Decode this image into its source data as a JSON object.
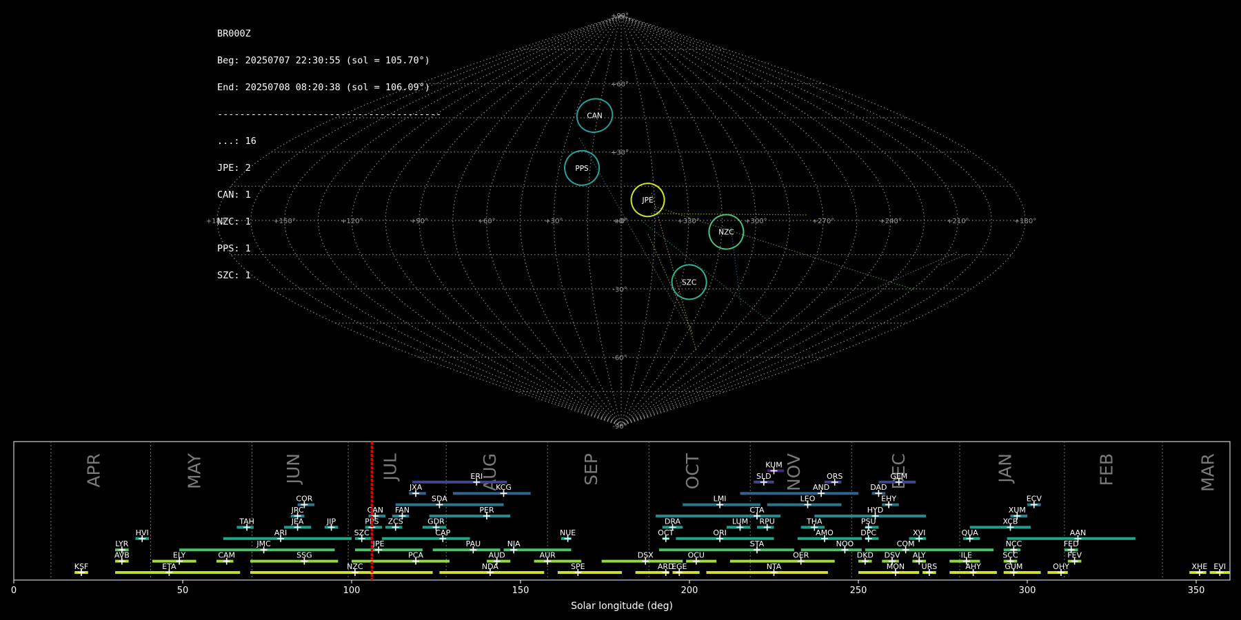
{
  "header": {
    "station": "BR000Z",
    "beg": "Beg: 20250707 22:30:55 (sol = 105.70°)",
    "end": "End: 20250708 08:20:38 (sol = 106.09°)",
    "divider": "----------------------------------------",
    "counts": [
      "...: 16",
      "JPE: 2",
      "CAN: 1",
      "NZC: 1",
      "PPS: 1",
      "SZC: 1"
    ]
  },
  "sky_map": {
    "projection": "sinusoidal",
    "lon_labels": [
      "+180°",
      "+150°",
      "+120°",
      "+90°",
      "+60°",
      "+30°",
      "+0°",
      "+330°",
      "+300°",
      "+270°",
      "+240°",
      "+210°",
      "+180°"
    ],
    "lat_labels": [
      "+90°",
      "+60°",
      "+30°",
      "+0°",
      "-30°",
      "-60°",
      "-90°"
    ],
    "lat_label_values": [
      90,
      60,
      30,
      0,
      -30,
      -60,
      -90
    ],
    "showers": [
      {
        "code": "CAN",
        "lon": -17,
        "lat": 46,
        "rx": 26,
        "ry": 24,
        "color": "#2a9e9e"
      },
      {
        "code": "PPS",
        "lon": -19,
        "lat": 23,
        "rx": 25,
        "ry": 25,
        "color": "#28a3a0"
      },
      {
        "code": "JPE",
        "lon": 12,
        "lat": 9,
        "rx": 24,
        "ry": 24,
        "color": "#cfe02a"
      },
      {
        "code": "NZC",
        "lon": 47,
        "lat": -5,
        "rx": 25,
        "ry": 25,
        "color": "#48c47a"
      },
      {
        "code": "SZC",
        "lon": 34,
        "lat": -27,
        "rx": 25,
        "ry": 25,
        "color": "#31b39a"
      }
    ]
  },
  "chart_data": {
    "type": "range_timeline",
    "xlabel": "Solar longitude (deg)",
    "xlim": [
      0,
      360
    ],
    "xticks": [
      0,
      50,
      100,
      150,
      200,
      250,
      300,
      350
    ],
    "current_sol": 106,
    "months": [
      {
        "name": "APR",
        "start": 11
      },
      {
        "name": "MAY",
        "start": 40.5
      },
      {
        "name": "JUN",
        "start": 70.5
      },
      {
        "name": "JUL",
        "start": 99
      },
      {
        "name": "AUG",
        "start": 128
      },
      {
        "name": "SEP",
        "start": 158
      },
      {
        "name": "OCT",
        "start": 188
      },
      {
        "name": "NOV",
        "start": 218
      },
      {
        "name": "DEC",
        "start": 248
      },
      {
        "name": "JAN",
        "start": 280
      },
      {
        "name": "FEB",
        "start": 311
      },
      {
        "name": "MAR",
        "start": 340
      }
    ],
    "showers": [
      {
        "code": "KSF",
        "start": 18,
        "end": 22,
        "peak": 20,
        "row": 0,
        "color": "#cfe02a"
      },
      {
        "code": "ETA",
        "start": 30,
        "end": 67,
        "peak": 46,
        "row": 0,
        "color": "#b8de29"
      },
      {
        "code": "NZC",
        "start": 70,
        "end": 124,
        "peak": 101,
        "row": 0,
        "color": "#cfe02a"
      },
      {
        "code": "NDA",
        "start": 126,
        "end": 157,
        "peak": 141,
        "row": 0,
        "color": "#cfe02a"
      },
      {
        "code": "SPE",
        "start": 161,
        "end": 180,
        "peak": 167,
        "row": 0,
        "color": "#cfe02a"
      },
      {
        "code": "ARD",
        "start": 184,
        "end": 194,
        "peak": 193,
        "row": 0,
        "color": "#cfe02a"
      },
      {
        "code": "EGE",
        "start": 195,
        "end": 203,
        "peak": 197,
        "row": 0,
        "color": "#cfe02a"
      },
      {
        "code": "NTA",
        "start": 205,
        "end": 241,
        "peak": 225,
        "row": 0,
        "color": "#cfe02a"
      },
      {
        "code": "MON",
        "start": 250,
        "end": 268,
        "peak": 261,
        "row": 0,
        "color": "#cfe02a"
      },
      {
        "code": "URS",
        "start": 269,
        "end": 273,
        "peak": 271,
        "row": 0,
        "color": "#cfe02a"
      },
      {
        "code": "AHY",
        "start": 277,
        "end": 291,
        "peak": 284,
        "row": 0,
        "color": "#cfe02a"
      },
      {
        "code": "GUM",
        "start": 293,
        "end": 304,
        "peak": 296,
        "row": 0,
        "color": "#cfe02a"
      },
      {
        "code": "OHY",
        "start": 306,
        "end": 312,
        "peak": 310,
        "row": 0,
        "color": "#cfe02a"
      },
      {
        "code": "XHE",
        "start": 348,
        "end": 353,
        "peak": 351,
        "row": 0,
        "color": "#cfe02a"
      },
      {
        "code": "EVI",
        "start": 354,
        "end": 360,
        "peak": 357,
        "row": 0,
        "color": "#cfe02a"
      },
      {
        "code": "AVB",
        "start": 30,
        "end": 34,
        "peak": 32,
        "row": 1,
        "color": "#b8de29"
      },
      {
        "code": "ELY",
        "start": 41,
        "end": 54,
        "peak": 49,
        "row": 1,
        "color": "#a5db36"
      },
      {
        "code": "CAM",
        "start": 60,
        "end": 65,
        "peak": 63,
        "row": 1,
        "color": "#a5db36"
      },
      {
        "code": "SSG",
        "start": 70,
        "end": 96,
        "peak": 86,
        "row": 1,
        "color": "#93d741"
      },
      {
        "code": "PCA",
        "start": 100,
        "end": 129,
        "peak": 119,
        "row": 1,
        "color": "#93d741"
      },
      {
        "code": "AUD",
        "start": 140,
        "end": 147,
        "peak": 143,
        "row": 1,
        "color": "#93d741"
      },
      {
        "code": "AUR",
        "start": 154,
        "end": 168,
        "peak": 158,
        "row": 1,
        "color": "#93d741"
      },
      {
        "code": "DSX",
        "start": 174,
        "end": 198,
        "peak": 187,
        "row": 1,
        "color": "#93d741"
      },
      {
        "code": "OCU",
        "start": 199,
        "end": 208,
        "peak": 202,
        "row": 1,
        "color": "#a5db36"
      },
      {
        "code": "OER",
        "start": 212,
        "end": 243,
        "peak": 233,
        "row": 1,
        "color": "#a5db36"
      },
      {
        "code": "DKD",
        "start": 250,
        "end": 254,
        "peak": 252,
        "row": 1,
        "color": "#93d741"
      },
      {
        "code": "DSV",
        "start": 257,
        "end": 262,
        "peak": 260,
        "row": 1,
        "color": "#93d741"
      },
      {
        "code": "ALY",
        "start": 266,
        "end": 270,
        "peak": 268,
        "row": 1,
        "color": "#93d741"
      },
      {
        "code": "ILE",
        "start": 277,
        "end": 286,
        "peak": 282,
        "row": 1,
        "color": "#93d741"
      },
      {
        "code": "SCC",
        "start": 293,
        "end": 297,
        "peak": 295,
        "row": 1,
        "color": "#93d741"
      },
      {
        "code": "FEV",
        "start": 312,
        "end": 316,
        "peak": 314,
        "row": 1,
        "color": "#93d741"
      },
      {
        "code": "LYR",
        "start": 30,
        "end": 34,
        "peak": 32,
        "row": 2,
        "color": "#5ec962"
      },
      {
        "code": "JMC",
        "start": 49,
        "end": 95,
        "peak": 74,
        "row": 2,
        "color": "#4ac16d"
      },
      {
        "code": "JPE",
        "start": 101,
        "end": 121,
        "peak": 108,
        "row": 2,
        "color": "#4ac16d"
      },
      {
        "code": "PAU",
        "start": 124,
        "end": 144,
        "peak": 136,
        "row": 2,
        "color": "#4ac16d"
      },
      {
        "code": "NIA",
        "start": 145,
        "end": 165,
        "peak": 148,
        "row": 2,
        "color": "#4ac16d"
      },
      {
        "code": "STA",
        "start": 191,
        "end": 231,
        "peak": 220,
        "row": 2,
        "color": "#4ac16d"
      },
      {
        "code": "NOO",
        "start": 233,
        "end": 251,
        "peak": 246,
        "row": 2,
        "color": "#4ac16d"
      },
      {
        "code": "COM",
        "start": 252,
        "end": 290,
        "peak": 264,
        "row": 2,
        "color": "#4ac16d"
      },
      {
        "code": "NCC",
        "start": 293,
        "end": 298,
        "peak": 296,
        "row": 2,
        "color": "#4ac16d"
      },
      {
        "code": "FED",
        "start": 311,
        "end": 315,
        "peak": 313,
        "row": 2,
        "color": "#4ac16d"
      },
      {
        "code": "HVI",
        "start": 36,
        "end": 40,
        "peak": 38,
        "row": 3,
        "color": "#22a884"
      },
      {
        "code": "ARI",
        "start": 62,
        "end": 100,
        "peak": 79,
        "row": 3,
        "color": "#22a884"
      },
      {
        "code": "SZC",
        "start": 101,
        "end": 106,
        "peak": 103,
        "row": 3,
        "color": "#22a884"
      },
      {
        "code": "CAP",
        "start": 109,
        "end": 135,
        "peak": 127,
        "row": 3,
        "color": "#22a884"
      },
      {
        "code": "NUE",
        "start": 162,
        "end": 165,
        "peak": 164,
        "row": 3,
        "color": "#22a884"
      },
      {
        "code": "OCT",
        "start": 192,
        "end": 194,
        "peak": 193,
        "row": 3,
        "color": "#22a884"
      },
      {
        "code": "ORI",
        "start": 196,
        "end": 225,
        "peak": 209,
        "row": 3,
        "color": "#22a884"
      },
      {
        "code": "AMO",
        "start": 232,
        "end": 251,
        "peak": 240,
        "row": 3,
        "color": "#22a884"
      },
      {
        "code": "DPC",
        "start": 252,
        "end": 256,
        "peak": 253,
        "row": 3,
        "color": "#22a884"
      },
      {
        "code": "XVI",
        "start": 265,
        "end": 270,
        "peak": 268,
        "row": 3,
        "color": "#22a884"
      },
      {
        "code": "QUA",
        "start": 281,
        "end": 286,
        "peak": 283,
        "row": 3,
        "color": "#22a884"
      },
      {
        "code": "AAN",
        "start": 294,
        "end": 332,
        "peak": 315,
        "row": 3,
        "color": "#22a884"
      },
      {
        "code": "TAH",
        "start": 66,
        "end": 71,
        "peak": 69,
        "row": 4,
        "color": "#1f9e89"
      },
      {
        "code": "JEA",
        "start": 80,
        "end": 88,
        "peak": 84,
        "row": 4,
        "color": "#1f9e89"
      },
      {
        "code": "JIP",
        "start": 92,
        "end": 96,
        "peak": 94,
        "row": 4,
        "color": "#1f9e89"
      },
      {
        "code": "PPS",
        "start": 104,
        "end": 109,
        "peak": 106,
        "row": 4,
        "color": "#1f9e89"
      },
      {
        "code": "ZCS",
        "start": 110,
        "end": 115,
        "peak": 113,
        "row": 4,
        "color": "#1f9e89"
      },
      {
        "code": "GDR",
        "start": 121,
        "end": 128,
        "peak": 125,
        "row": 4,
        "color": "#1f9e89"
      },
      {
        "code": "DRA",
        "start": 192,
        "end": 198,
        "peak": 195,
        "row": 4,
        "color": "#1f9e89"
      },
      {
        "code": "LUM",
        "start": 211,
        "end": 218,
        "peak": 215,
        "row": 4,
        "color": "#1f9e89"
      },
      {
        "code": "RPU",
        "start": 220,
        "end": 225,
        "peak": 223,
        "row": 4,
        "color": "#1f9e89"
      },
      {
        "code": "THA",
        "start": 233,
        "end": 240,
        "peak": 237,
        "row": 4,
        "color": "#1f9e89"
      },
      {
        "code": "PSU",
        "start": 252,
        "end": 256,
        "peak": 253,
        "row": 4,
        "color": "#1f9e89"
      },
      {
        "code": "XCB",
        "start": 283,
        "end": 301,
        "peak": 295,
        "row": 4,
        "color": "#1f9e89"
      },
      {
        "code": "JRC",
        "start": 82,
        "end": 86,
        "peak": 84,
        "row": 5,
        "color": "#23898e"
      },
      {
        "code": "CAN",
        "start": 105,
        "end": 110,
        "peak": 107,
        "row": 5,
        "color": "#23898e"
      },
      {
        "code": "FAN",
        "start": 112,
        "end": 117,
        "peak": 115,
        "row": 5,
        "color": "#23898e"
      },
      {
        "code": "PER",
        "start": 123,
        "end": 147,
        "peak": 140,
        "row": 5,
        "color": "#23898e"
      },
      {
        "code": "CTA",
        "start": 190,
        "end": 227,
        "peak": 220,
        "row": 5,
        "color": "#23898e"
      },
      {
        "code": "HYD",
        "start": 237,
        "end": 270,
        "peak": 255,
        "row": 5,
        "color": "#23898e"
      },
      {
        "code": "XUM",
        "start": 295,
        "end": 300,
        "peak": 297,
        "row": 5,
        "color": "#23898e"
      },
      {
        "code": "COR",
        "start": 84,
        "end": 89,
        "peak": 86,
        "row": 6,
        "color": "#2a788e"
      },
      {
        "code": "SDA",
        "start": 113,
        "end": 145,
        "peak": 126,
        "row": 6,
        "color": "#2a788e"
      },
      {
        "code": "LMI",
        "start": 198,
        "end": 221,
        "peak": 209,
        "row": 6,
        "color": "#2a788e"
      },
      {
        "code": "LEO",
        "start": 223,
        "end": 245,
        "peak": 235,
        "row": 6,
        "color": "#2a788e"
      },
      {
        "code": "EHY",
        "start": 257,
        "end": 262,
        "peak": 259,
        "row": 6,
        "color": "#2a788e"
      },
      {
        "code": "ECV",
        "start": 300,
        "end": 304,
        "peak": 302,
        "row": 6,
        "color": "#2a788e"
      },
      {
        "code": "JXA",
        "start": 117,
        "end": 122,
        "peak": 119,
        "row": 7,
        "color": "#33638d"
      },
      {
        "code": "KCG",
        "start": 130,
        "end": 153,
        "peak": 145,
        "row": 7,
        "color": "#33638d"
      },
      {
        "code": "AND",
        "start": 215,
        "end": 250,
        "peak": 239,
        "row": 7,
        "color": "#33638d"
      },
      {
        "code": "DAD",
        "start": 254,
        "end": 258,
        "peak": 256,
        "row": 7,
        "color": "#33638d"
      },
      {
        "code": "ERI",
        "start": 118,
        "end": 146,
        "peak": 137,
        "row": 8,
        "color": "#3f4788"
      },
      {
        "code": "SLD",
        "start": 219,
        "end": 225,
        "peak": 222,
        "row": 8,
        "color": "#3f4788"
      },
      {
        "code": "ORS",
        "start": 240,
        "end": 245,
        "peak": 243,
        "row": 8,
        "color": "#3f4788"
      },
      {
        "code": "GEM",
        "start": 256,
        "end": 267,
        "peak": 262,
        "row": 8,
        "color": "#3f4788"
      },
      {
        "code": "KUM",
        "start": 223,
        "end": 228,
        "peak": 225,
        "row": 9,
        "color": "#482677"
      }
    ]
  }
}
